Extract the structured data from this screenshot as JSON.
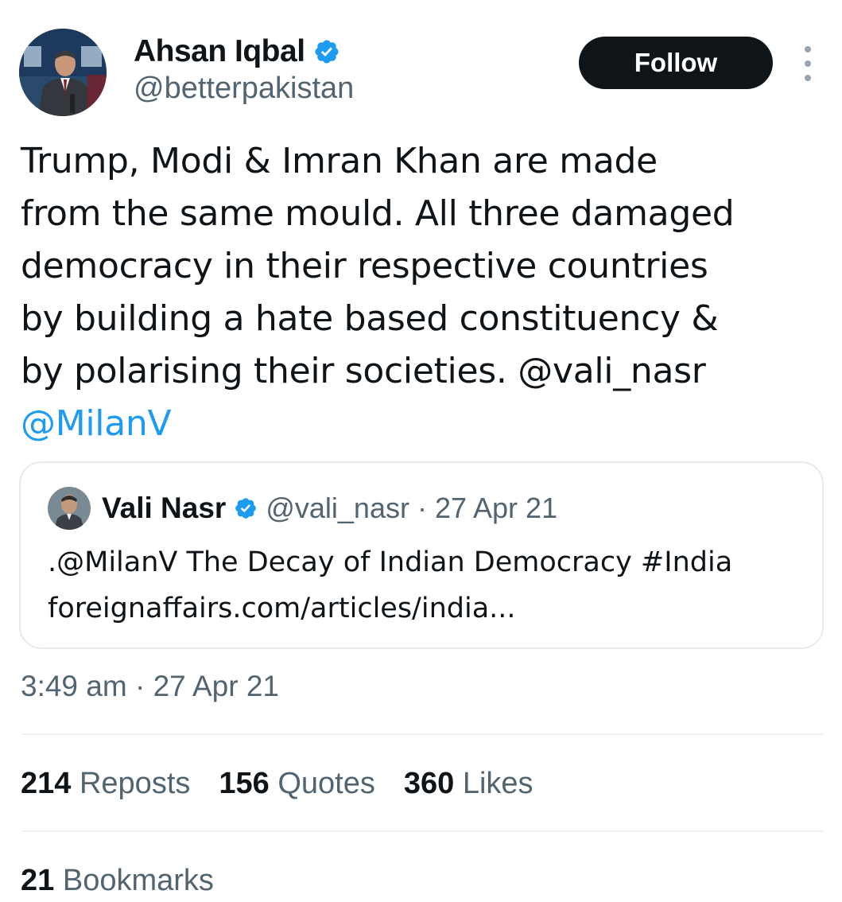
{
  "author": {
    "display_name": "Ahsan Iqbal",
    "handle": "@betterpakistan",
    "avatar_icon": "profile-photo-icon",
    "verified_icon": "verified-badge-icon"
  },
  "actions": {
    "follow_label": "Follow",
    "more_icon": "more-options-icon"
  },
  "tweet": {
    "lines": [
      "Trump, Modi & Imran Khan are made",
      "from the same mould. All three damaged",
      "democracy in their respective countries",
      "by building a hate based constituency &",
      "by polarising their societies. "
    ],
    "mention_inline": "@vali_nasr",
    "mention_last": "@MilanV"
  },
  "quoted": {
    "display_name": "Vali Nasr",
    "handle": "@vali_nasr",
    "separator": " · ",
    "date": "27 Apr 21",
    "text_line_1": ".@MilanV The Decay of Indian Democracy #India",
    "text_line_2": "foreignaffairs.com/articles/india..."
  },
  "meta": {
    "time": "3:49 am",
    "separator": " · ",
    "date": "27 Apr 21"
  },
  "stats": {
    "reposts_count": "214",
    "reposts_label": "Reposts",
    "quotes_count": "156",
    "quotes_label": "Quotes",
    "likes_count": "360",
    "likes_label": "Likes",
    "bookmarks_count": "21",
    "bookmarks_label": "Bookmarks"
  },
  "colors": {
    "accent": "#1d9bf0",
    "text": "#0f1419",
    "muted": "#536471",
    "button_bg": "#0f1419"
  }
}
